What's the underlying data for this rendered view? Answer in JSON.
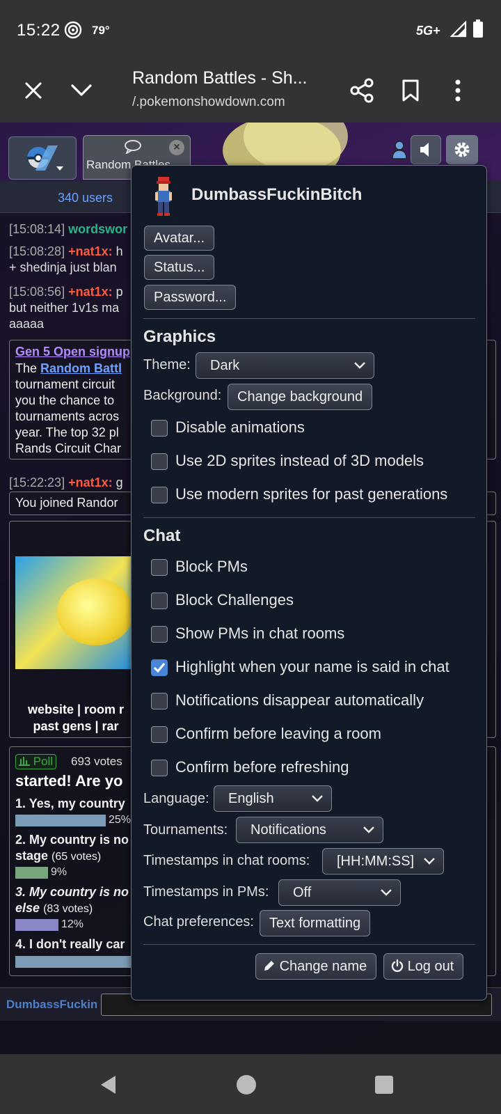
{
  "status_bar": {
    "time": "15:22",
    "temperature": "79°",
    "network": "5G+",
    "icons": [
      "hotspot-icon",
      "cell-signal-icon",
      "battery-icon"
    ]
  },
  "browser": {
    "title": "Random Battles - Sh...",
    "url": "/.pokemonshowdown.com",
    "icons": [
      "close-icon",
      "chevron-down-icon",
      "share-icon",
      "bookmark-icon",
      "more-vert-icon"
    ]
  },
  "tabs": {
    "room_label": "Random Battles"
  },
  "chat": {
    "user_count": "340 users",
    "lines": [
      {
        "ts": "[15:08:14]",
        "user": "wordswor",
        "text": ""
      },
      {
        "ts": "[15:08:28]",
        "user": "+nat1x:",
        "text": "h",
        "cont": "+ shedinja just blan"
      },
      {
        "ts": "[15:08:56]",
        "user": "+nat1x:",
        "text": "p",
        "cont": "but neither 1v1s ma",
        "cont2": "aaaaa"
      },
      {
        "ts": "[15:22:23]",
        "user": "+nat1x:",
        "text": "g"
      }
    ],
    "announcement": {
      "title": "Gen 5 Open signup",
      "body": [
        "The Random Battl",
        "tournament circuit",
        "you the chance to",
        "tournaments acros",
        "year. The top 32 pl",
        "Rands Circuit Char"
      ],
      "link": "Random Battl"
    },
    "joined": "You joined Randor",
    "promo_links": [
      "website | room r",
      "past gens | rar"
    ],
    "poll": {
      "badge": "Poll",
      "votes": "693 votes",
      "question": "started! Are yo",
      "options": [
        {
          "label": "1. Yes, my country",
          "pct": "25%",
          "fraction": 0.25,
          "color": "#7b9bb6"
        },
        {
          "label": "2. My country is no",
          "label2": "stage",
          "votes": "(65 votes)",
          "pct": "9%",
          "fraction": 0.09,
          "color": "#7aa67e"
        },
        {
          "label": "3. My country is no",
          "label2": "else",
          "votes": "(83 votes)",
          "pct": "12%",
          "fraction": 0.12,
          "color": "#8a86c8"
        },
        {
          "label": "4. I don't really car",
          "fraction": 0.55,
          "color": "#7b9bb6"
        }
      ]
    },
    "me": "DumbassFuckinBitch"
  },
  "options": {
    "username": "DumbassFuckinBitch",
    "buttons": {
      "avatar": "Avatar...",
      "status": "Status...",
      "password": "Password..."
    },
    "graphics": {
      "title": "Graphics",
      "theme_label": "Theme:",
      "theme_value": "Dark",
      "background_label": "Background:",
      "background_button": "Change background",
      "checks": [
        {
          "label": "Disable animations",
          "checked": false
        },
        {
          "label": "Use 2D sprites instead of 3D models",
          "checked": false
        },
        {
          "label": "Use modern sprites for past generations",
          "checked": false
        }
      ]
    },
    "chat": {
      "title": "Chat",
      "checks": [
        {
          "label": "Block PMs",
          "checked": false
        },
        {
          "label": "Block Challenges",
          "checked": false
        },
        {
          "label": "Show PMs in chat rooms",
          "checked": false
        },
        {
          "label": "Highlight when your name is said in chat",
          "checked": true
        },
        {
          "label": "Notifications disappear automatically",
          "checked": false
        },
        {
          "label": "Confirm before leaving a room",
          "checked": false
        },
        {
          "label": "Confirm before refreshing",
          "checked": false
        }
      ],
      "language_label": "Language:",
      "language_value": "English",
      "tournaments_label": "Tournaments:",
      "tournaments_value": "Notifications",
      "timestamps_rooms_label": "Timestamps in chat rooms:",
      "timestamps_rooms_value": "[HH:MM:SS]",
      "timestamps_pms_label": "Timestamps in PMs:",
      "timestamps_pms_value": "Off",
      "chat_prefs_label": "Chat preferences:",
      "chat_prefs_button": "Text formatting"
    },
    "footer": {
      "change_name": "Change name",
      "log_out": "Log out"
    }
  },
  "nav": {
    "icons": [
      "back-icon",
      "home-icon",
      "recents-icon"
    ]
  }
}
